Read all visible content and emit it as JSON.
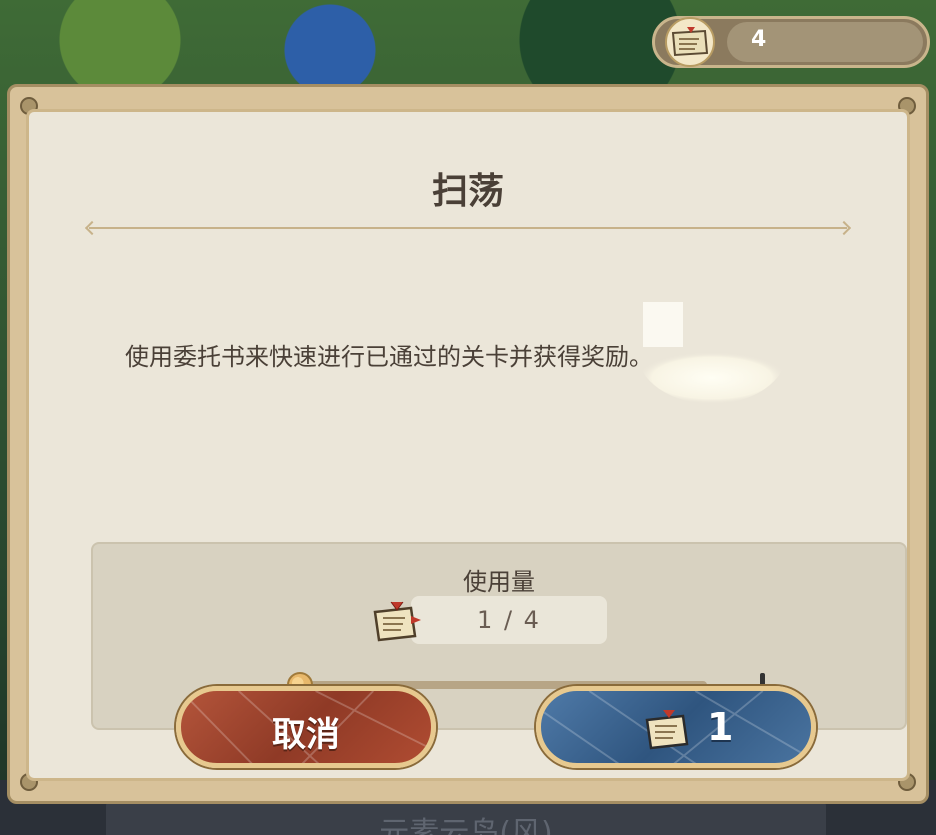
{
  "background": {
    "stage_name": "元素云岛(风)"
  },
  "resource_bar": {
    "icon": "commission-book-icon",
    "count": "4"
  },
  "dialog": {
    "title": "扫荡",
    "description": "使用委托书来快速进行已通过的关卡并获得奖励。",
    "usage": {
      "label": "使用量",
      "icon": "commission-book-icon",
      "quantity_text": "1 / 4",
      "selected": 1,
      "max": 4,
      "slider_min": 1
    },
    "buttons": {
      "cancel_label": "取消",
      "confirm_cost": "1",
      "confirm_icon": "commission-book-icon"
    }
  },
  "colors": {
    "cancel_button": "#a8492f",
    "confirm_button": "#3f6792",
    "frame": "#d8c29a",
    "panel_bg": "#ebe6d9"
  }
}
